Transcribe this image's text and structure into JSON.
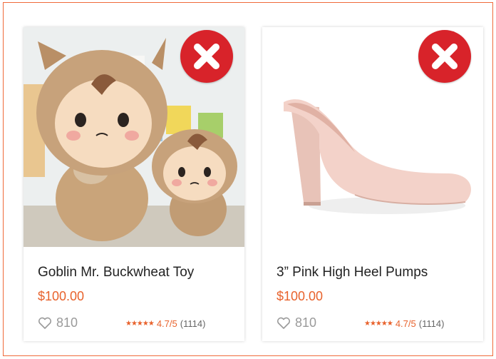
{
  "products": [
    {
      "title": "Goblin Mr. Buckwheat Toy",
      "price": "$100.00",
      "likes": "810",
      "rating_score": "4.7/5",
      "rating_count": "(1114)",
      "image_subject": "plush-toy"
    },
    {
      "title": "3” Pink High Heel Pumps",
      "price": "$100.00",
      "likes": "810",
      "rating_score": "4.7/5",
      "rating_count": "(1114)",
      "image_subject": "pink-pump-shoe"
    }
  ],
  "badge_icon": "reject-x-icon",
  "colors": {
    "frame_border": "#f06a3a",
    "price": "#e8622c",
    "badge": "#d8232a",
    "likes": "#9a9a9a"
  }
}
